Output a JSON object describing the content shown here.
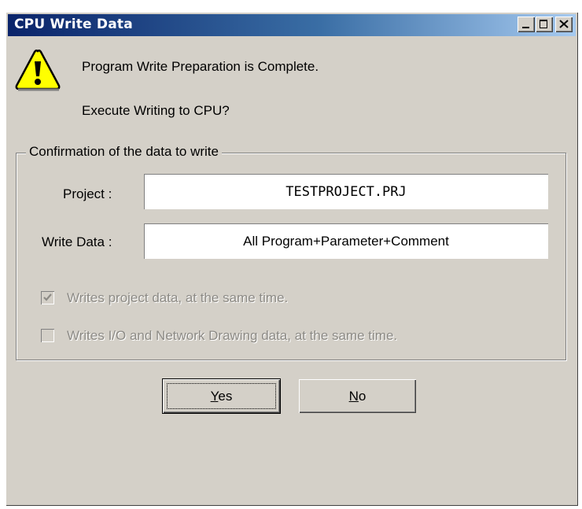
{
  "window": {
    "title": "CPU Write Data",
    "controls": [
      "minimize",
      "maximize",
      "close"
    ]
  },
  "message": {
    "icon": "warning-icon",
    "line1": "Program Write Preparation is Complete.",
    "line2": "Execute Writing to CPU?"
  },
  "group": {
    "legend": "Confirmation of the data to write",
    "project_label": "Project :",
    "project_value": "TESTPROJECT.PRJ",
    "write_data_label": "Write Data :",
    "write_data_value": "All Program+Parameter+Comment",
    "checkboxes": [
      {
        "label": "Writes project data, at the same time.",
        "checked": true,
        "enabled": false
      },
      {
        "label": "Writes I/O and Network Drawing data, at the same time.",
        "checked": false,
        "enabled": false
      }
    ]
  },
  "buttons": {
    "yes_mnemonic": "Y",
    "yes_rest": "es",
    "no_mnemonic": "N",
    "no_rest": "o"
  },
  "colors": {
    "title_start": "#0a246a",
    "title_end": "#a6caf0",
    "face": "#d4d0c8",
    "disabled_text": "#8c8a85"
  }
}
